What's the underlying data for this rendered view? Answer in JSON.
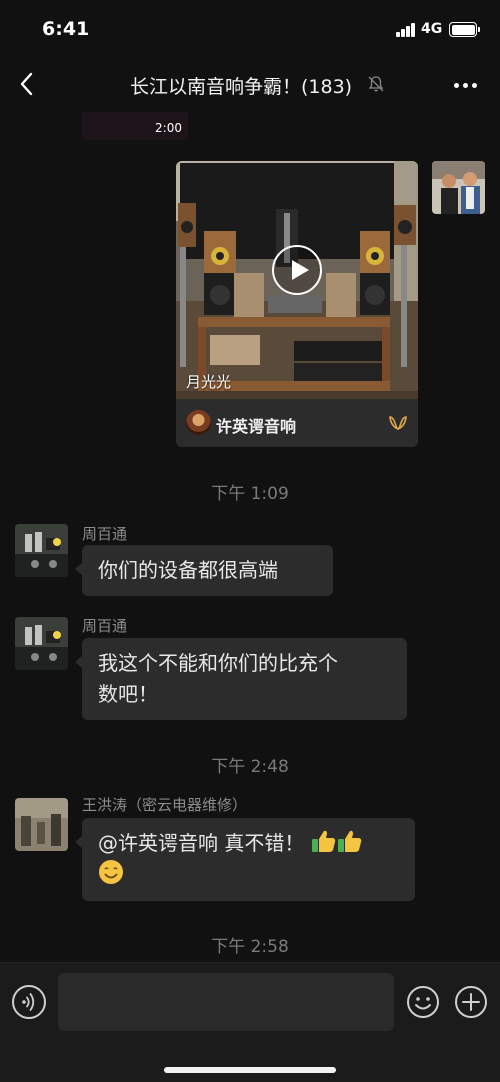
{
  "status_bar": {
    "time": "6:41",
    "network": "4G"
  },
  "header": {
    "title": "长江以南音响争霸！(183)"
  },
  "chat": {
    "previous_video": {
      "duration": "2:00"
    },
    "video_message": {
      "caption": "月光光",
      "channel_name": "许英谔音响"
    },
    "timestamps": [
      "下午 1:09",
      "下午 2:48",
      "下午 2:58"
    ],
    "messages": [
      {
        "sender": "周百通",
        "text": "你们的设备都很高端"
      },
      {
        "sender": "周百通",
        "text_line1": "我这个不能和你们的比充个",
        "text_line2": "数吧！"
      },
      {
        "sender": "王洪涛（密云电器维修）",
        "text_line1": "@许英谔音响 真不错！"
      }
    ]
  },
  "colors": {
    "background": "#111111",
    "bubble": "#2c2c2c",
    "timestamp": "#7a7a7a",
    "sender": "#8c8c8c"
  }
}
